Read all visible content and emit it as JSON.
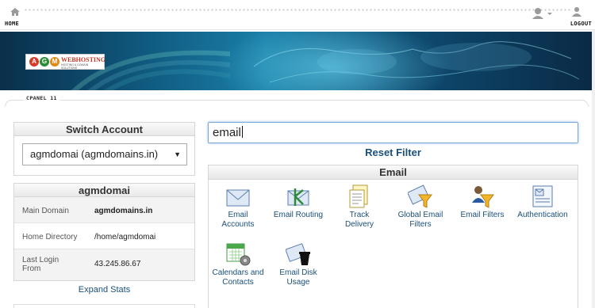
{
  "topbar": {
    "home_label": "HOME",
    "logout_label": "LOGOUT",
    "icons": [
      "home-icon",
      "user-icon",
      "logout-icon"
    ]
  },
  "banner": {
    "logo_letters": [
      "A",
      "G",
      "M"
    ],
    "logo_text": "WEBHOSTING",
    "logo_tagline": "HOSTING & DOMAIN SOLUTIONS"
  },
  "cpanel_label": "CPANEL 11",
  "switch_account": {
    "title": "Switch Account",
    "selected": "agmdomai (agmdomains.in)"
  },
  "stats": {
    "title": "agmdomai",
    "rows": [
      {
        "label": "Main Domain",
        "value": "agmdomains.in"
      },
      {
        "label": "Home Directory",
        "value": "/home/agmdomai"
      },
      {
        "label": "Last Login From",
        "value": "43.245.86.67"
      }
    ],
    "expand_label": "Expand Stats"
  },
  "search": {
    "value": "email"
  },
  "reset_filter": "Reset Filter",
  "email_section": {
    "title": "Email",
    "tools": [
      {
        "label1": "Email",
        "label2": "Accounts",
        "icon": "envelope-icon"
      },
      {
        "label1": "Email Routing",
        "label2": "",
        "icon": "routing-icon"
      },
      {
        "label1": "Track",
        "label2": "Delivery",
        "icon": "track-delivery-icon"
      },
      {
        "label1": "Global Email",
        "label2": "Filters",
        "icon": "global-filter-icon"
      },
      {
        "label1": "Email Filters",
        "label2": "",
        "icon": "email-filter-icon"
      },
      {
        "label1": "Authentication",
        "label2": "",
        "icon": "authentication-icon"
      },
      {
        "label1": "Calendars and",
        "label2": "Contacts",
        "icon": "calendar-icon"
      },
      {
        "label1": "Email Disk",
        "label2": "Usage",
        "icon": "disk-usage-icon"
      }
    ]
  },
  "colors": {
    "link": "#1a4f7a",
    "banner": "#0f557a",
    "focus": "#7aa9d6"
  }
}
